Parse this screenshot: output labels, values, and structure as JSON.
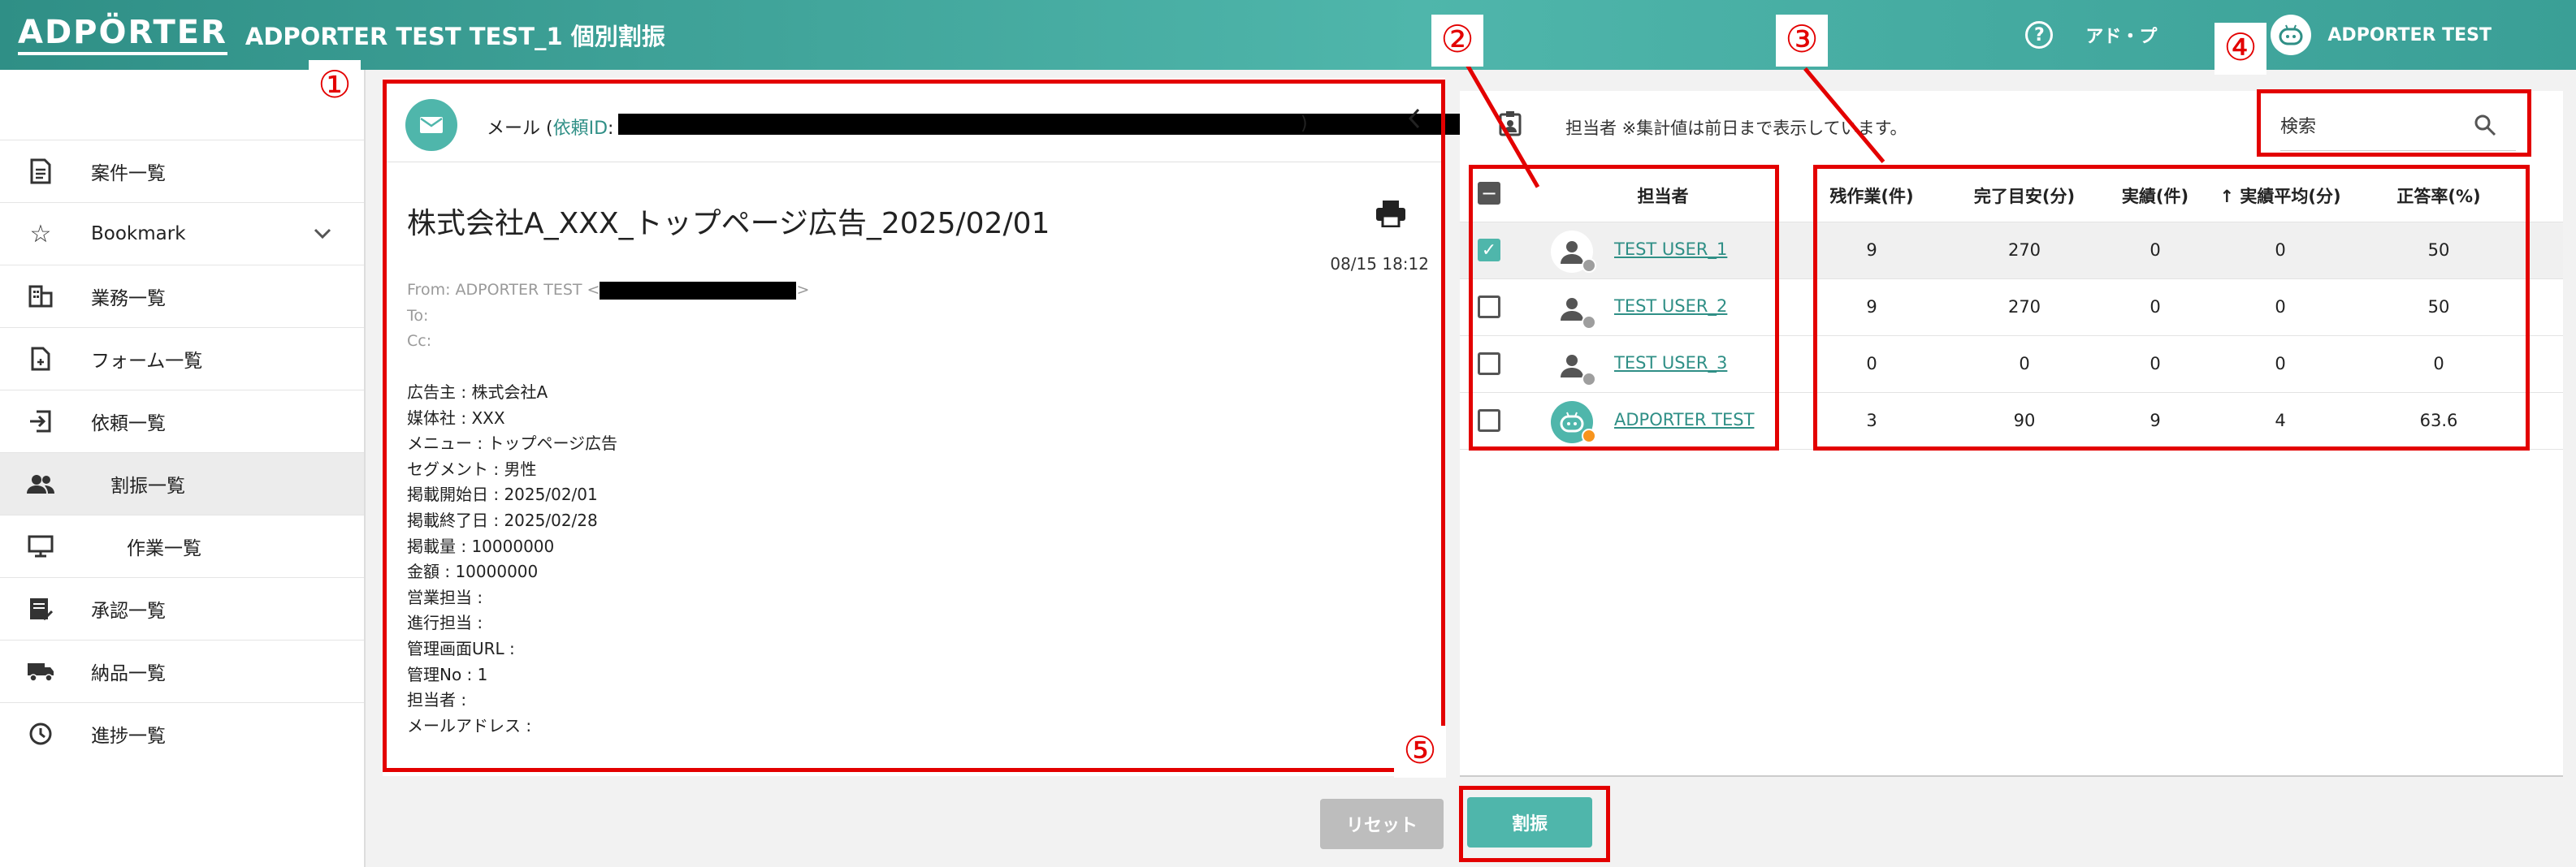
{
  "header": {
    "logo": "ADPÖRTER",
    "title": "ADPORTER TEST TEST_1 個別割振",
    "role": "アド・プ",
    "user_name": "ADPORTER TEST",
    "help_glyph": "?"
  },
  "sidebar": {
    "items": [
      {
        "label": "案件一覧",
        "icon": "document-list-icon"
      },
      {
        "label": "Bookmark",
        "icon": "star-icon"
      },
      {
        "label": "業務一覧",
        "icon": "building-icon"
      },
      {
        "label": "フォーム一覧",
        "icon": "form-icon"
      },
      {
        "label": "依頼一覧",
        "icon": "inbox-icon"
      },
      {
        "label": "割振一覧",
        "icon": "people-icon"
      },
      {
        "label": "作業一覧",
        "icon": "monitor-icon"
      },
      {
        "label": "承認一覧",
        "icon": "approval-icon"
      },
      {
        "label": "納品一覧",
        "icon": "truck-icon"
      },
      {
        "label": "進捗一覧",
        "icon": "clock-icon"
      }
    ]
  },
  "mail": {
    "type_label": "メール (",
    "request_link": "依頼ID",
    "colon": ":",
    "close_paren": ")",
    "subject": "株式会社A_XXX_トップページ広告_2025/02/01",
    "date": "08/15 18:12",
    "from": "From: ADPORTER TEST <",
    "from_end": ">",
    "to": "To:",
    "cc": "Cc:",
    "body_lines": [
      "広告主 : 株式会社A",
      "媒体社 : XXX",
      "メニュー : トップページ広告",
      "セグメント : 男性",
      "掲載開始日 : 2025/02/01",
      "掲載終了日 : 2025/02/28",
      "掲載量 : 10000000",
      "金額 : 10000000",
      "営業担当 :",
      "進行担当 :",
      "管理画面URL :",
      "管理No : 1",
      "担当者 :",
      "メールアドレス :"
    ]
  },
  "assign": {
    "note": "担当者 ※集計値は前日まで表示しています。",
    "search_placeholder": "検索",
    "columns": {
      "assignee": "担当者",
      "remaining": "残作業(件)",
      "estimate": "完了目安(分)",
      "actual": "実績(件)",
      "avg": "↑ 実績平均(分)",
      "accuracy": "正答率(%)"
    },
    "rows": [
      {
        "name": "TEST USER_1",
        "checked": true,
        "remaining": "9",
        "estimate": "270",
        "actual": "0",
        "avg": "0",
        "accuracy": "50"
      },
      {
        "name": "TEST USER_2",
        "checked": false,
        "remaining": "9",
        "estimate": "270",
        "actual": "0",
        "avg": "0",
        "accuracy": "50"
      },
      {
        "name": "TEST USER_3",
        "checked": false,
        "remaining": "0",
        "estimate": "0",
        "actual": "0",
        "avg": "0",
        "accuracy": "0"
      },
      {
        "name": "ADPORTER TEST",
        "checked": false,
        "remaining": "3",
        "estimate": "90",
        "actual": "9",
        "avg": "4",
        "accuracy": "63.6"
      }
    ]
  },
  "buttons": {
    "reset": "リセット",
    "assign": "割振"
  },
  "annotations": [
    "①",
    "②",
    "③",
    "④",
    "⑤"
  ],
  "colors": {
    "accent": "#4fb6ab",
    "header": "#2f8f86",
    "annotation": "#e30000"
  }
}
